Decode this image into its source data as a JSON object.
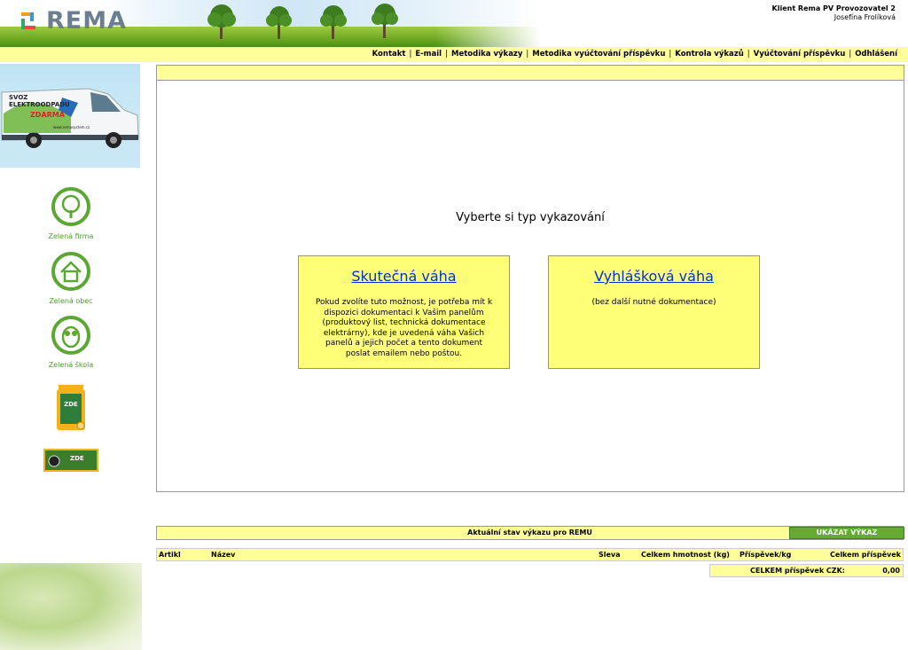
{
  "header": {
    "logo_text": "REMA",
    "client_label": "Klient Rema PV Provozovatel 2",
    "user_name": "Josefína Frolíková"
  },
  "nav": {
    "items": [
      {
        "label": "Kontakt"
      },
      {
        "label": "E-mail"
      },
      {
        "label": "Metodika výkazy"
      },
      {
        "label": "Metodika vyúčtování příspěvku"
      },
      {
        "label": "Kontrola výkazů"
      },
      {
        "label": "Vyúčtování příspěvku"
      },
      {
        "label": "Odhlášení"
      }
    ]
  },
  "sidebar": {
    "van": {
      "line1": "SVOZ",
      "line2": "ELEKTROODPADU",
      "line3": "ZDARMA",
      "url": "www.remasystem.cz"
    },
    "badges": [
      {
        "label": "Zelená firma",
        "icon": "tree-icon"
      },
      {
        "label": "Zelená obec",
        "icon": "house-icon"
      },
      {
        "label": "Zelená škola",
        "icon": "owl-icon"
      }
    ],
    "bin_label": "ZDE",
    "battery_label": "ZDE"
  },
  "main": {
    "title": "Vyberte si typ vykazování",
    "cards": [
      {
        "title": "Skutečná váha",
        "description": "Pokud zvolíte tuto možnost, je potřeba mít k dispozici dokumentaci k Vašim panelům (produktový list, technická dokumentace elektrárny), kde je uvedená váha Vašich panelů a jejich počet a tento dokument poslat emailem nebo poštou."
      },
      {
        "title": "Vyhlášková váha",
        "description": "(bez další nutné dokumentace)"
      }
    ]
  },
  "status": {
    "title": "Aktuální stav výkazu pro REMU",
    "show_button": "UKÁZAT VÝKAZ",
    "columns": {
      "artikl": "Artikl",
      "nazev": "Název",
      "sleva": "Sleva",
      "hmotnost": "Celkem hmotnost (kg)",
      "prispevek_kg": "Příspěvek/kg",
      "prispevek": "Celkem příspěvek"
    },
    "total_label": "CELKEM příspěvek CZK:",
    "total_value": "0,00"
  },
  "colors": {
    "nav_yellow": "#ffff99",
    "card_yellow": "#ffff77",
    "green_accent": "#4a9d2c",
    "link_blue": "#0033cc"
  }
}
